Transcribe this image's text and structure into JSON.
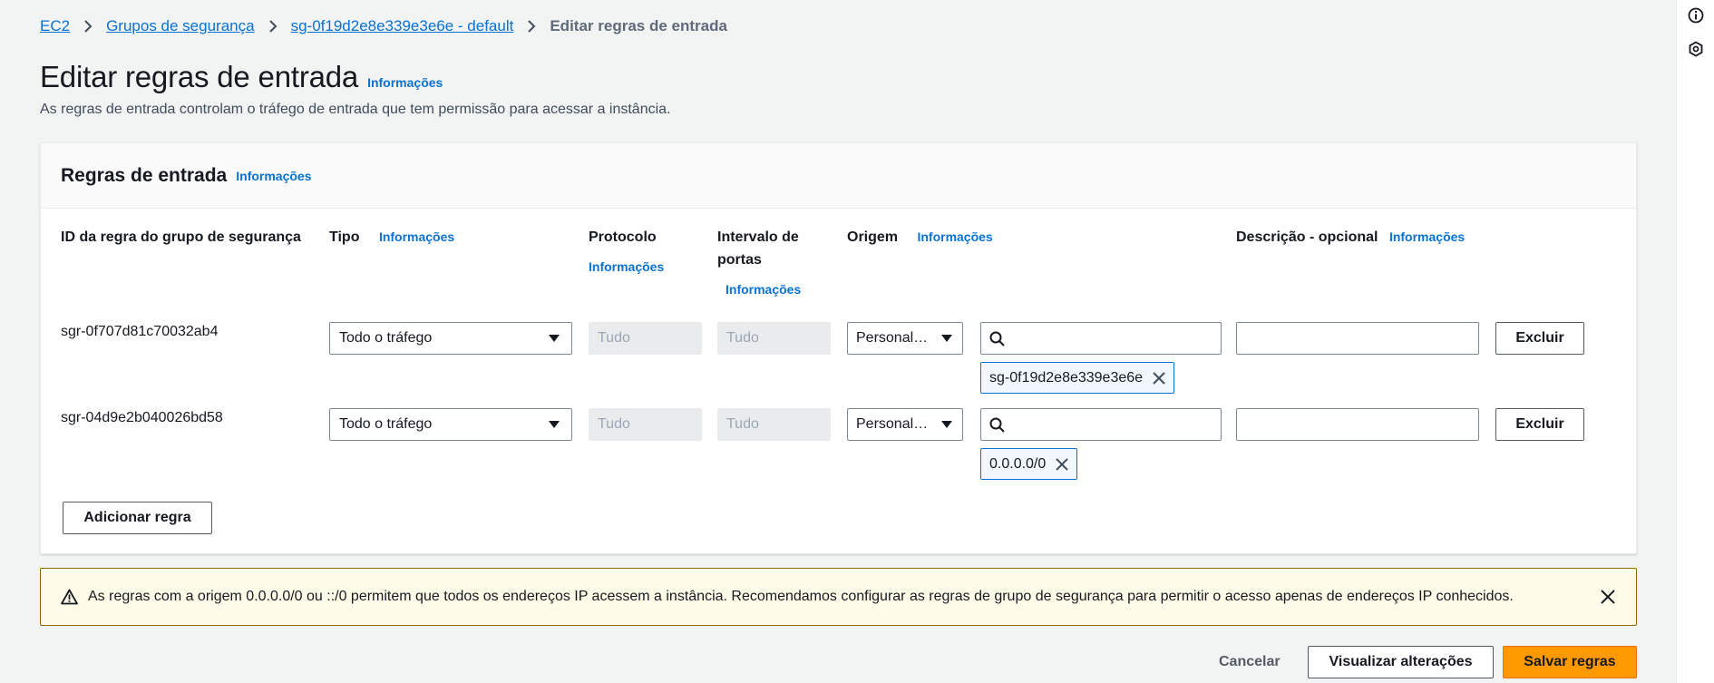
{
  "breadcrumb": {
    "items": [
      "EC2",
      "Grupos de segurança",
      "sg-0f19d2e8e339e3e6e - default"
    ],
    "current": "Editar regras de entrada"
  },
  "header": {
    "title": "Editar regras de entrada",
    "info": "Informações",
    "description": "As regras de entrada controlam o tráfego de entrada que tem permissão para acessar a instância."
  },
  "container": {
    "title": "Regras de entrada",
    "info": "Informações",
    "columns": {
      "rule_id": "ID da regra do grupo de segurança",
      "type": "Tipo",
      "type_info": "Informações",
      "protocol": "Protocolo",
      "protocol_info": "Informações",
      "port_range": "Intervalo de portas",
      "port_range_info": "Informações",
      "source": "Origem",
      "source_info": "Informações",
      "description": "Descrição - opcional",
      "description_info": "Informações"
    },
    "rules": [
      {
        "id": "sgr-0f707d81c70032ab4",
        "type": "Todo o tráfego",
        "protocol": "Tudo",
        "port_range": "Tudo",
        "source_type": "Personal…",
        "source_search": "",
        "source_token": "sg-0f19d2e8e339e3e6e",
        "description": "",
        "delete_label": "Excluir"
      },
      {
        "id": "sgr-04d9e2b040026bd58",
        "type": "Todo o tráfego",
        "protocol": "Tudo",
        "port_range": "Tudo",
        "source_type": "Personal…",
        "source_search": "",
        "source_token": "0.0.0.0/0",
        "description": "",
        "delete_label": "Excluir"
      }
    ],
    "add_rule_label": "Adicionar regra"
  },
  "alert": {
    "text": "As regras com a origem 0.0.0.0/0 ou ::/0 permitem que todos os endereços IP acessem a instância. Recomendamos configurar as regras de grupo de segurança para permitir o acesso apenas de endereços IP conhecidos."
  },
  "actions": {
    "cancel": "Cancelar",
    "preview": "Visualizar alterações",
    "save": "Salvar regras"
  },
  "colors": {
    "link": "#0972d3",
    "primary": "#ff9900",
    "warning_bg": "#fffce9",
    "warning_border": "#906806",
    "token_bg": "#f2f8fd"
  },
  "icons": {
    "rail_top": "info-icon",
    "rail_bottom": "tool-icon",
    "alert": "warning-icon"
  }
}
